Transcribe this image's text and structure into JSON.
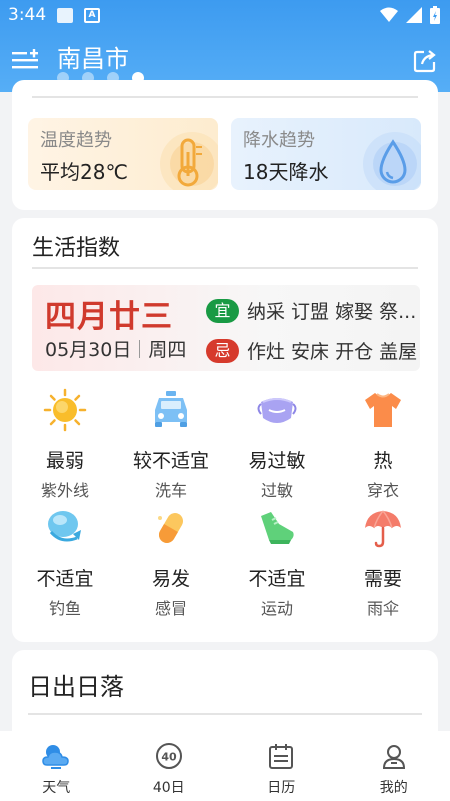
{
  "status": {
    "time": "3:44"
  },
  "header": {
    "title": "南昌市",
    "page_dots": 4,
    "active_dot": 3
  },
  "trends": {
    "temperature": {
      "label": "温度趋势",
      "value": "平均28℃"
    },
    "precipitation": {
      "label": "降水趋势",
      "value": "18天降水"
    }
  },
  "life": {
    "title": "生活指数",
    "almanac": {
      "lunar_date": "四月廿三",
      "date": "05月30日",
      "weekday": "周四",
      "yi_badge": "宜",
      "yi_text": "纳采 订盟 嫁娶 祭...",
      "ji_badge": "忌",
      "ji_text": "作灶 安床 开仓 盖屋"
    },
    "indices": [
      {
        "level": "最弱",
        "name": "紫外线",
        "icon": "sun-icon"
      },
      {
        "level": "较不适宜",
        "name": "洗车",
        "icon": "car-icon"
      },
      {
        "level": "易过敏",
        "name": "过敏",
        "icon": "mask-icon"
      },
      {
        "level": "热",
        "name": "穿衣",
        "icon": "shirt-icon"
      },
      {
        "level": "不适宜",
        "name": "钓鱼",
        "icon": "fishing-icon"
      },
      {
        "level": "易发",
        "name": "感冒",
        "icon": "pill-icon"
      },
      {
        "level": "不适宜",
        "name": "运动",
        "icon": "shoe-icon"
      },
      {
        "level": "需要",
        "name": "雨伞",
        "icon": "umbrella-icon"
      }
    ]
  },
  "sun": {
    "title": "日出日落"
  },
  "nav": [
    {
      "label": "天气",
      "icon": "weather-icon",
      "active": true
    },
    {
      "label": "40日",
      "icon": "forty-day-icon",
      "active": false
    },
    {
      "label": "日历",
      "icon": "calendar-icon",
      "active": false
    },
    {
      "label": "我的",
      "icon": "profile-icon",
      "active": false
    }
  ],
  "colors": {
    "header": "#3d9bf0",
    "lunar_red": "#d03a2d",
    "yi_green": "#199a44",
    "ji_red": "#d63a2c"
  }
}
